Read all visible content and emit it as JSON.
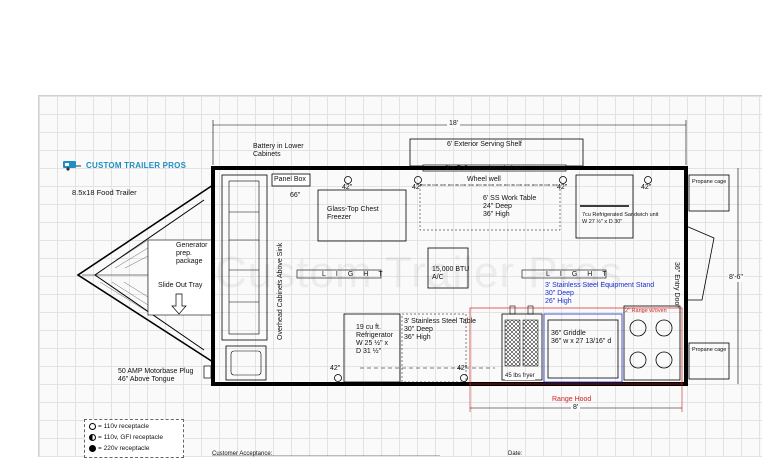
{
  "brand": {
    "name": "CUSTOM TRAILER PROS",
    "subtitle": "8.5x18 Food Trailer",
    "color": "#1e8fc4"
  },
  "watermark": "Custom Trailer Pros",
  "dimensions": {
    "overall_length": "18'",
    "width": "8'-6\"",
    "hood_length": "8'",
    "door_width": "66\""
  },
  "labels": {
    "battery": "Battery in Lower Cabinets",
    "panel_box": "Panel Box",
    "serving_shelf": "6' Exterior Serving Shelf",
    "concession_window": "3' x 5' Concession window",
    "wheel_well": "Wheel well",
    "freezer": "Glass-Top Chest Freezer",
    "work_table": "6' SS Work Table\n24\" Deep\n36\" High",
    "sandwich_unit": "7cu Refrigerated Sandwich unit\nW 27 ½\" x D 30\"",
    "propane_top": "Propane cage",
    "propane_bottom": "Propane cage",
    "entry_door": "36\" Entry Door",
    "overhead_cabinets": "Overhead Cabinets Above Sink",
    "generator": "Generator prep. package",
    "slide_out": "Slide Out Tray",
    "ac": "15,000 BTU\nA/C",
    "light": "LIGHT",
    "equipment_stand": "3' Stainless Steel Equipment Stand\n30\" Deep\n26\" High",
    "range": "2\" Range w/oven",
    "refrigerator": "19 cu ft.\nRefrigerator\nW 25 ½\" x\nD 31 ½\"",
    "ss_table": "3' Stainless Steel Table\n30\" Deep\n36\" High",
    "griddle": "36\" Griddle\n36\" w x 27 13/16\" d",
    "fryer": "45 lbs fryer",
    "range_hood": "Range Hood",
    "motorbase": "50 AMP Motorbase Plug\n46\" Above Tongue",
    "outlet_height": "42\"",
    "customer_acceptance": "Customer Acceptance:",
    "date": "Date:"
  },
  "legend": [
    {
      "icon": "outlet-110v-icon",
      "label": "= 110v receptacle"
    },
    {
      "icon": "outlet-gfi-icon",
      "label": "= 110v, GFI receptacle"
    },
    {
      "icon": "outlet-220v-icon",
      "label": "= 220v receptacle"
    }
  ],
  "colors": {
    "wall": "#000000",
    "equipment_stand": "#1a2fd0",
    "range_hood": "#d21f1f"
  }
}
